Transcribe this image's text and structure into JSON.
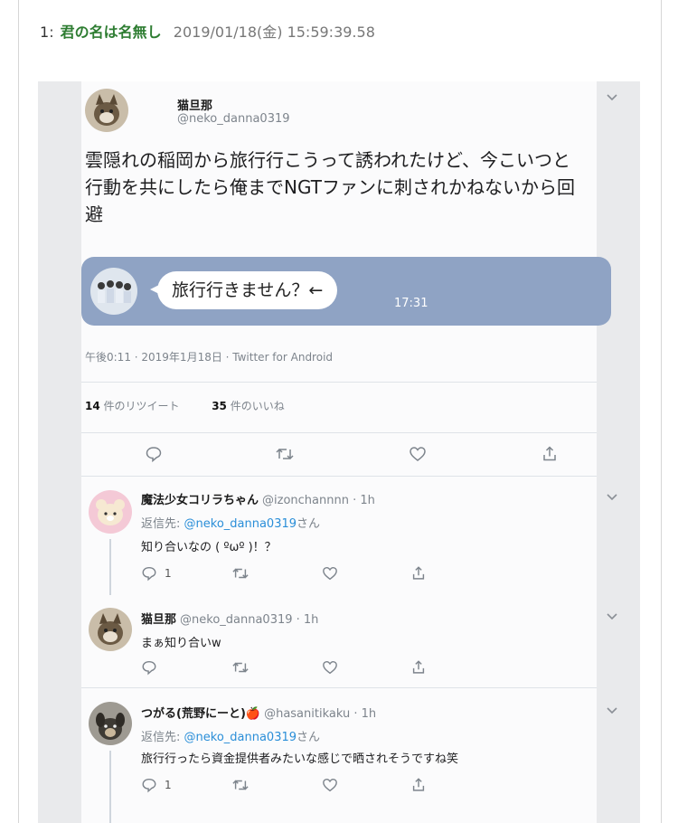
{
  "post": {
    "number": "1",
    "separator": ":",
    "author": "君の名は名無し",
    "datetime": "2019/01/18(金) 15:59:39.58"
  },
  "tweet": {
    "name": "猫旦那",
    "handle": "@neko_danna0319",
    "text": "雲隠れの稲岡から旅行行こうって誘われたけど、今こいつと行動を共にしたら俺までNGTファンに刺されかねないから回避",
    "line_message": "旅行行きません？←",
    "line_time": "17:31",
    "meta": "午後0:11 · 2019年1月18日 · Twitter for Android",
    "retweets_count": "14",
    "retweets_label": "件のリツイート",
    "likes_count": "35",
    "likes_label": "件のいいね"
  },
  "replies": [
    {
      "name": "魔法少女コリラちゃん",
      "handle": "@izonchannnn · 1h",
      "reply_to_prefix": "返信先: ",
      "reply_to_handle": "@neko_danna0319",
      "reply_to_suffix": "さん",
      "text": "知り合いなの ( ºωº )！？",
      "reply_count": "1"
    },
    {
      "name": "猫旦那",
      "handle": "@neko_danna0319 · 1h",
      "text": "まぁ知り合いw"
    },
    {
      "name": "つがる(荒野にーと)🍎",
      "handle": "@hasanitikaku · 1h",
      "reply_to_prefix": "返信先: ",
      "reply_to_handle": "@neko_danna0319",
      "reply_to_suffix": "さん",
      "text": "旅行行ったら資金提供者みたいな感じで晒されそうですね笑",
      "reply_count": "1"
    }
  ],
  "icons": [
    "chevron-down-icon",
    "reply-icon",
    "retweet-icon",
    "like-icon",
    "share-icon"
  ],
  "colors": {
    "author_green": "#2e7d32",
    "link_blue": "#2a8ed8",
    "line_card": "#8fa3c4"
  }
}
